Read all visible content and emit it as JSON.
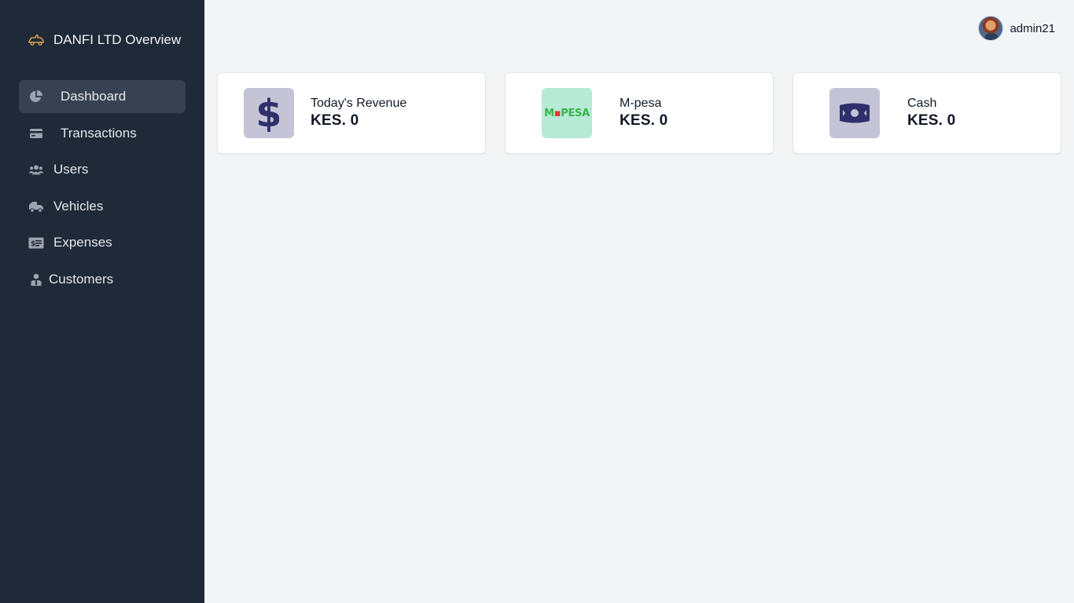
{
  "brand": {
    "title": "DANFI LTD Overview",
    "icon": "tow-truck-icon",
    "color": "#f0b44c"
  },
  "sidebar": {
    "items": [
      {
        "label": "Dashboard",
        "icon": "pie-chart-icon",
        "active": true
      },
      {
        "label": "Transactions",
        "icon": "credit-card-icon"
      },
      {
        "label": "Users",
        "icon": "users-icon"
      },
      {
        "label": "Vehicles",
        "icon": "truck-icon"
      },
      {
        "label": "Expenses",
        "icon": "money-check-icon"
      },
      {
        "label": "Customers",
        "icon": "user-tie-icon"
      }
    ]
  },
  "header": {
    "username": "admin21"
  },
  "cards": [
    {
      "label": "Today's Revenue",
      "value": "KES. 0",
      "icon": "dollar-icon"
    },
    {
      "label": "M-pesa",
      "value": "KES. 0",
      "icon": "mpesa-logo",
      "logo_text_left": "M",
      "logo_text_right": "PESA"
    },
    {
      "label": "Cash",
      "value": "KES. 0",
      "icon": "banknote-icon"
    }
  ],
  "colors": {
    "sidebar_bg": "#1f2937",
    "active_item_bg": "#374151",
    "page_bg": "#f3f4f6",
    "icon_navy": "#2f2f6b",
    "mpesa_green": "#3ab54a"
  }
}
